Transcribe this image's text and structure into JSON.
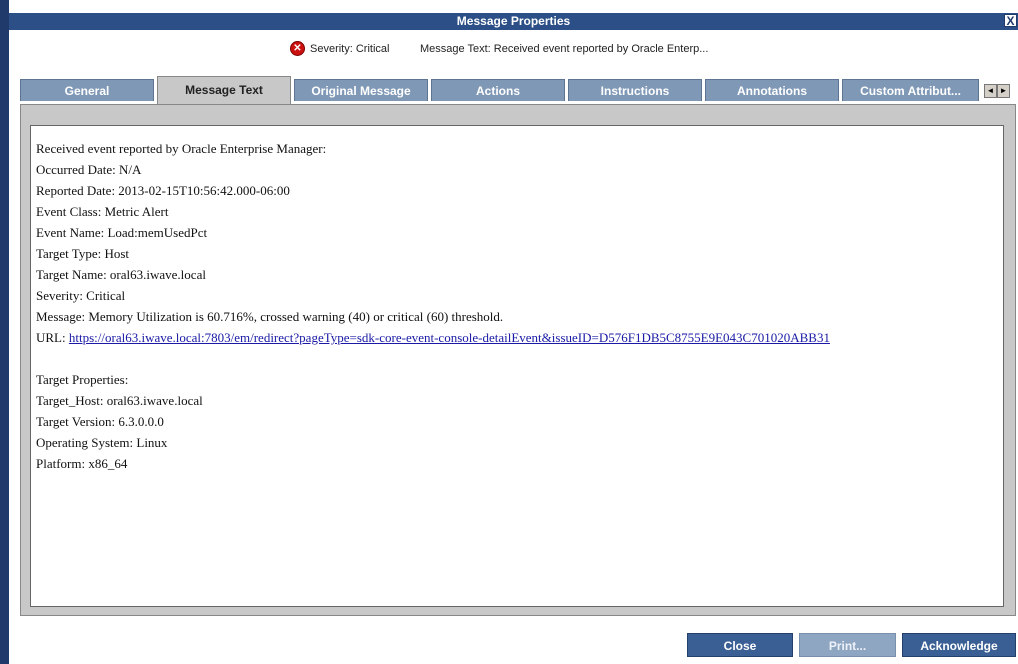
{
  "window": {
    "title": "Message Properties",
    "close_glyph": "X"
  },
  "info": {
    "severity_icon": "critical-x-icon",
    "severity_label": "Severity: Critical",
    "message_label": "Message Text: Received event reported by Oracle Enterp..."
  },
  "tabs": [
    {
      "label": "General"
    },
    {
      "label": "Message Text"
    },
    {
      "label": "Original Message"
    },
    {
      "label": "Actions"
    },
    {
      "label": "Instructions"
    },
    {
      "label": "Annotations"
    },
    {
      "label": "Custom Attribut..."
    }
  ],
  "active_tab": "Message Text",
  "tab_scroll": {
    "left": "◄",
    "right": "►"
  },
  "content": {
    "lines": [
      "Received event reported by Oracle Enterprise Manager:",
      "Occurred Date: N/A",
      "Reported Date: 2013-02-15T10:56:42.000-06:00",
      "Event Class: Metric Alert",
      "Event Name: Load:memUsedPct",
      "Target Type: Host",
      "Target Name: oral63.iwave.local",
      "Severity: Critical",
      "Message: Memory Utilization is 60.716%, crossed warning (40) or critical (60) threshold."
    ],
    "url_label": "URL: ",
    "url_link": "https://oral63.iwave.local:7803/em/redirect?pageType=sdk-core-event-console-detailEvent&issueID=D576F1DB5C8755E9E043C701020ABB31",
    "props": [
      "Target Properties:",
      "Target_Host: oral63.iwave.local",
      "Target Version: 6.3.0.0.0",
      "Operating System: Linux",
      "Platform: x86_64"
    ]
  },
  "buttons": {
    "close": "Close",
    "print": "Print...",
    "acknowledge": "Acknowledge"
  },
  "colors": {
    "titlebar": "#2b4f86",
    "tab": "#7f98b6",
    "active_tab": "#c8c8c8",
    "button": "#3a5f95",
    "critical": "#cc1111",
    "link": "#1a1aa6"
  }
}
